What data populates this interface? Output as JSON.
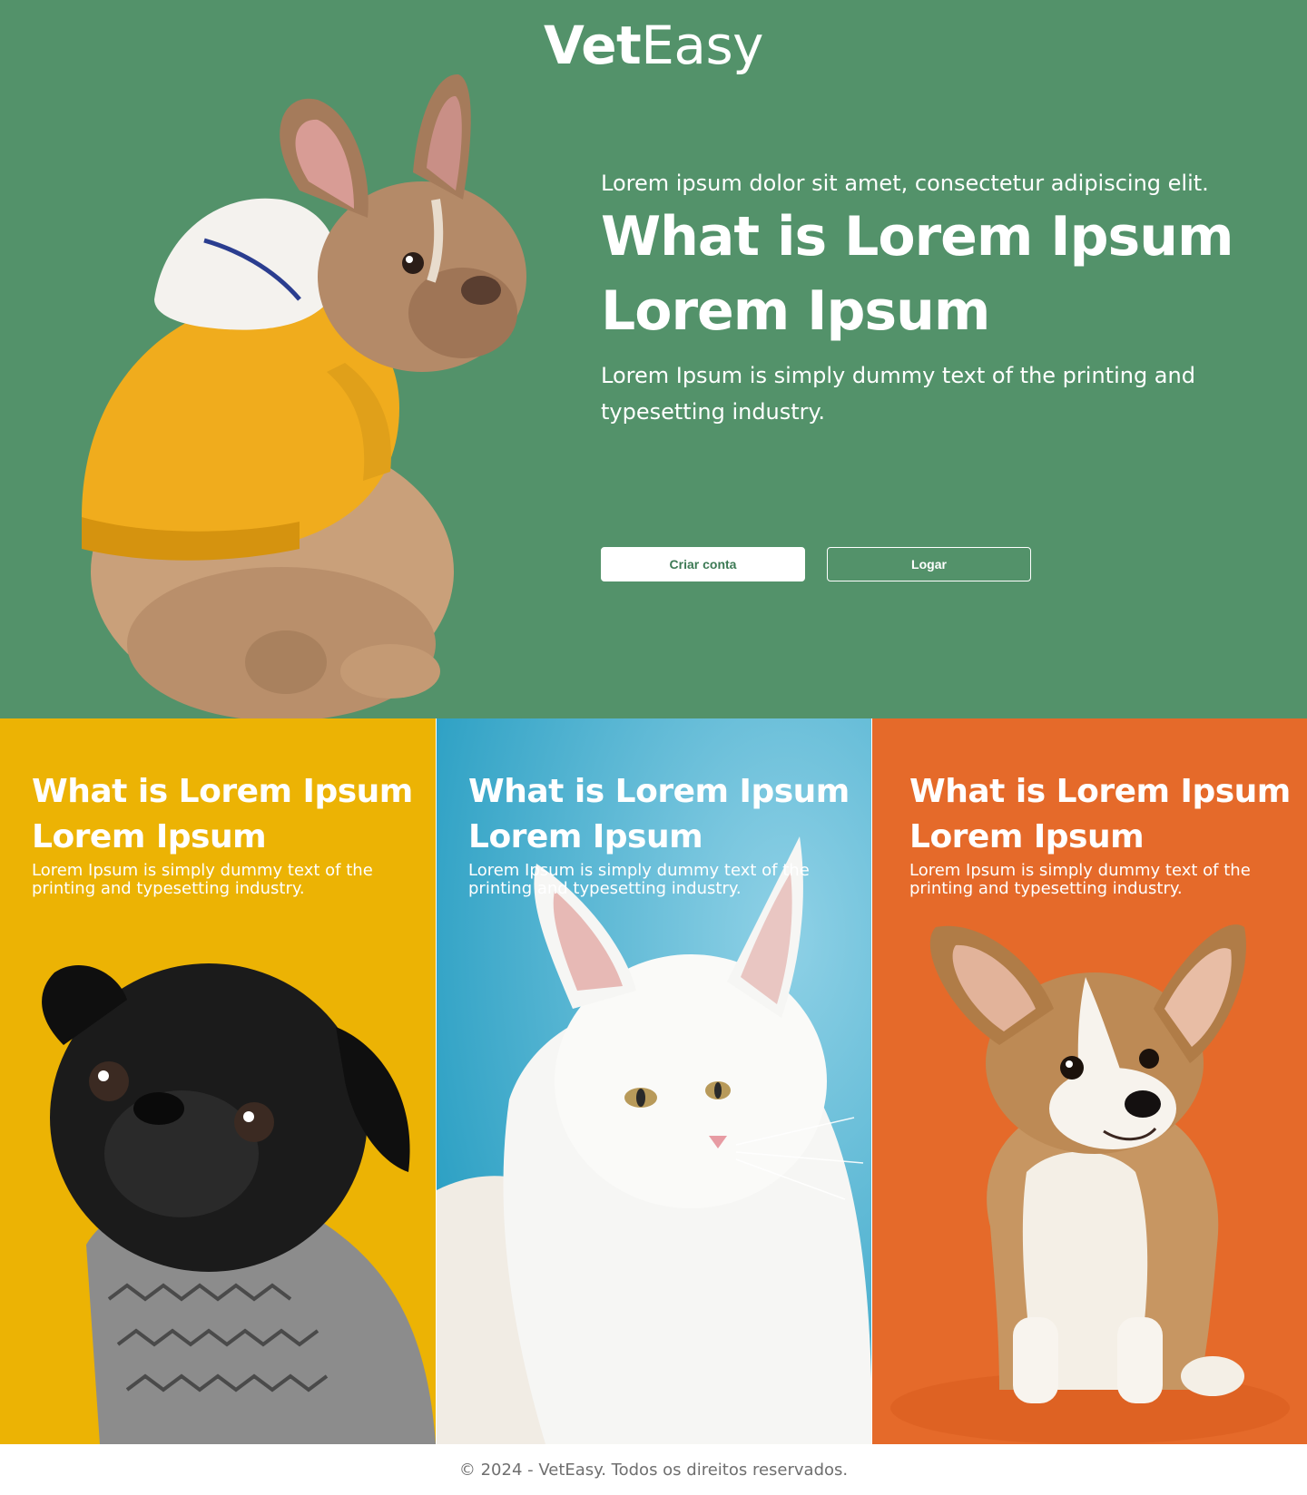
{
  "brand": {
    "name_bold": "Vet",
    "name_light": "Easy"
  },
  "hero": {
    "eyebrow": "Lorem ipsum dolor sit amet, consectetur adipiscing elit.",
    "title": "What is Lorem Ipsum Lorem Ipsum",
    "description": "Lorem Ipsum is simply dummy text of the printing and typesetting industry.",
    "primary_button": "Criar conta",
    "secondary_button": "Logar",
    "image": "french-bulldog-in-yellow-hoodie"
  },
  "cards": [
    {
      "title": "What is Lorem Ipsum Lorem Ipsum",
      "description": "Lorem Ipsum is simply dummy text of the printing and typesetting industry.",
      "background": "#ecb304",
      "image": "black-pug-in-sweater"
    },
    {
      "title": "What is Lorem Ipsum Lorem Ipsum",
      "description": "Lorem Ipsum is simply dummy text of the printing and typesetting industry.",
      "background": "#4ab4d2",
      "image": "white-fluffy-cat"
    },
    {
      "title": "What is Lorem Ipsum Lorem Ipsum",
      "description": "Lorem Ipsum is simply dummy text of the printing and typesetting industry.",
      "background": "#e56a2a",
      "image": "corgi-puppy"
    }
  ],
  "footer": {
    "text": "© 2024 - VetEasy. Todos os direitos reservados."
  },
  "colors": {
    "hero_bg": "#53926a",
    "primary_text": "#3d7a55",
    "white": "#ffffff"
  }
}
